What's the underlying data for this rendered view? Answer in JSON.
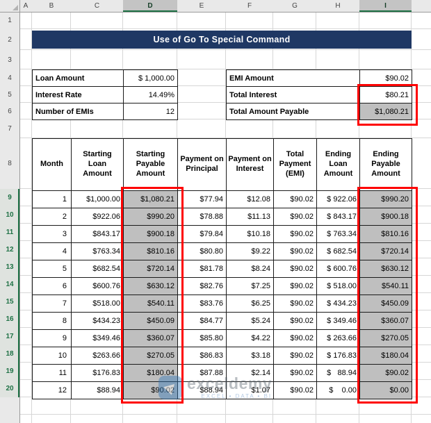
{
  "title": "Use of Go To Special Command",
  "sheet": {
    "col_headers": [
      "A",
      "B",
      "C",
      "D",
      "E",
      "F",
      "G",
      "H",
      "I"
    ],
    "row_headers": [
      "1",
      "2",
      "3",
      "4",
      "5",
      "6",
      "7",
      "8",
      "9",
      "10",
      "11",
      "12",
      "13",
      "14",
      "15",
      "16",
      "17",
      "18",
      "19",
      "20"
    ],
    "selected_columns": [
      "D",
      "I"
    ],
    "selected_rows": "9-20"
  },
  "loan_info": {
    "rows": [
      {
        "label": "Loan Amount",
        "value": "$ 1,000.00"
      },
      {
        "label": "Interest Rate",
        "value": "14.49%"
      },
      {
        "label": "Number of EMIs",
        "value": "12"
      }
    ]
  },
  "emi_info": {
    "rows": [
      {
        "label": "EMI Amount",
        "value": "$90.02"
      },
      {
        "label": "Total Interest",
        "value": "$80.21"
      },
      {
        "label": "Total Amount Payable",
        "value": "$1,080.21"
      }
    ]
  },
  "amortization": {
    "headers": [
      "Month",
      "Starting Loan Amount",
      "Starting Payable Amount",
      "Payment on Principal",
      "Payment on Interest",
      "Total Payment (EMI)",
      "Ending Loan Amount",
      "Ending Payable Amount"
    ],
    "rows": [
      [
        "1",
        "$1,000.00",
        "$1,080.21",
        "$77.94",
        "$12.08",
        "$90.02",
        "$ 922.06",
        "$990.20"
      ],
      [
        "2",
        "$922.06",
        "$990.20",
        "$78.88",
        "$11.13",
        "$90.02",
        "$ 843.17",
        "$900.18"
      ],
      [
        "3",
        "$843.17",
        "$900.18",
        "$79.84",
        "$10.18",
        "$90.02",
        "$ 763.34",
        "$810.16"
      ],
      [
        "4",
        "$763.34",
        "$810.16",
        "$80.80",
        "$9.22",
        "$90.02",
        "$ 682.54",
        "$720.14"
      ],
      [
        "5",
        "$682.54",
        "$720.14",
        "$81.78",
        "$8.24",
        "$90.02",
        "$ 600.76",
        "$630.12"
      ],
      [
        "6",
        "$600.76",
        "$630.12",
        "$82.76",
        "$7.25",
        "$90.02",
        "$ 518.00",
        "$540.11"
      ],
      [
        "7",
        "$518.00",
        "$540.11",
        "$83.76",
        "$6.25",
        "$90.02",
        "$ 434.23",
        "$450.09"
      ],
      [
        "8",
        "$434.23",
        "$450.09",
        "$84.77",
        "$5.24",
        "$90.02",
        "$ 349.46",
        "$360.07"
      ],
      [
        "9",
        "$349.46",
        "$360.07",
        "$85.80",
        "$4.22",
        "$90.02",
        "$ 263.66",
        "$270.05"
      ],
      [
        "10",
        "$263.66",
        "$270.05",
        "$86.83",
        "$3.18",
        "$90.02",
        "$ 176.83",
        "$180.04"
      ],
      [
        "11",
        "$176.83",
        "$180.04",
        "$87.88",
        "$2.14",
        "$90.02",
        "$   88.94",
        "$90.02"
      ],
      [
        "12",
        "$88.94",
        "$90.02",
        "$88.94",
        "$1.07",
        "$90.02",
        "$    0.00",
        "$0.00"
      ]
    ]
  },
  "watermark": {
    "logo_icon": "exceldemy-logo",
    "name": "exceldemy",
    "tagline": "EXCEL • DATA • BI"
  },
  "colors": {
    "banner": "#1F3864",
    "highlight_fill": "#BFBFBF",
    "alert_border": "#FF0000",
    "selection_green": "#1E7145"
  }
}
